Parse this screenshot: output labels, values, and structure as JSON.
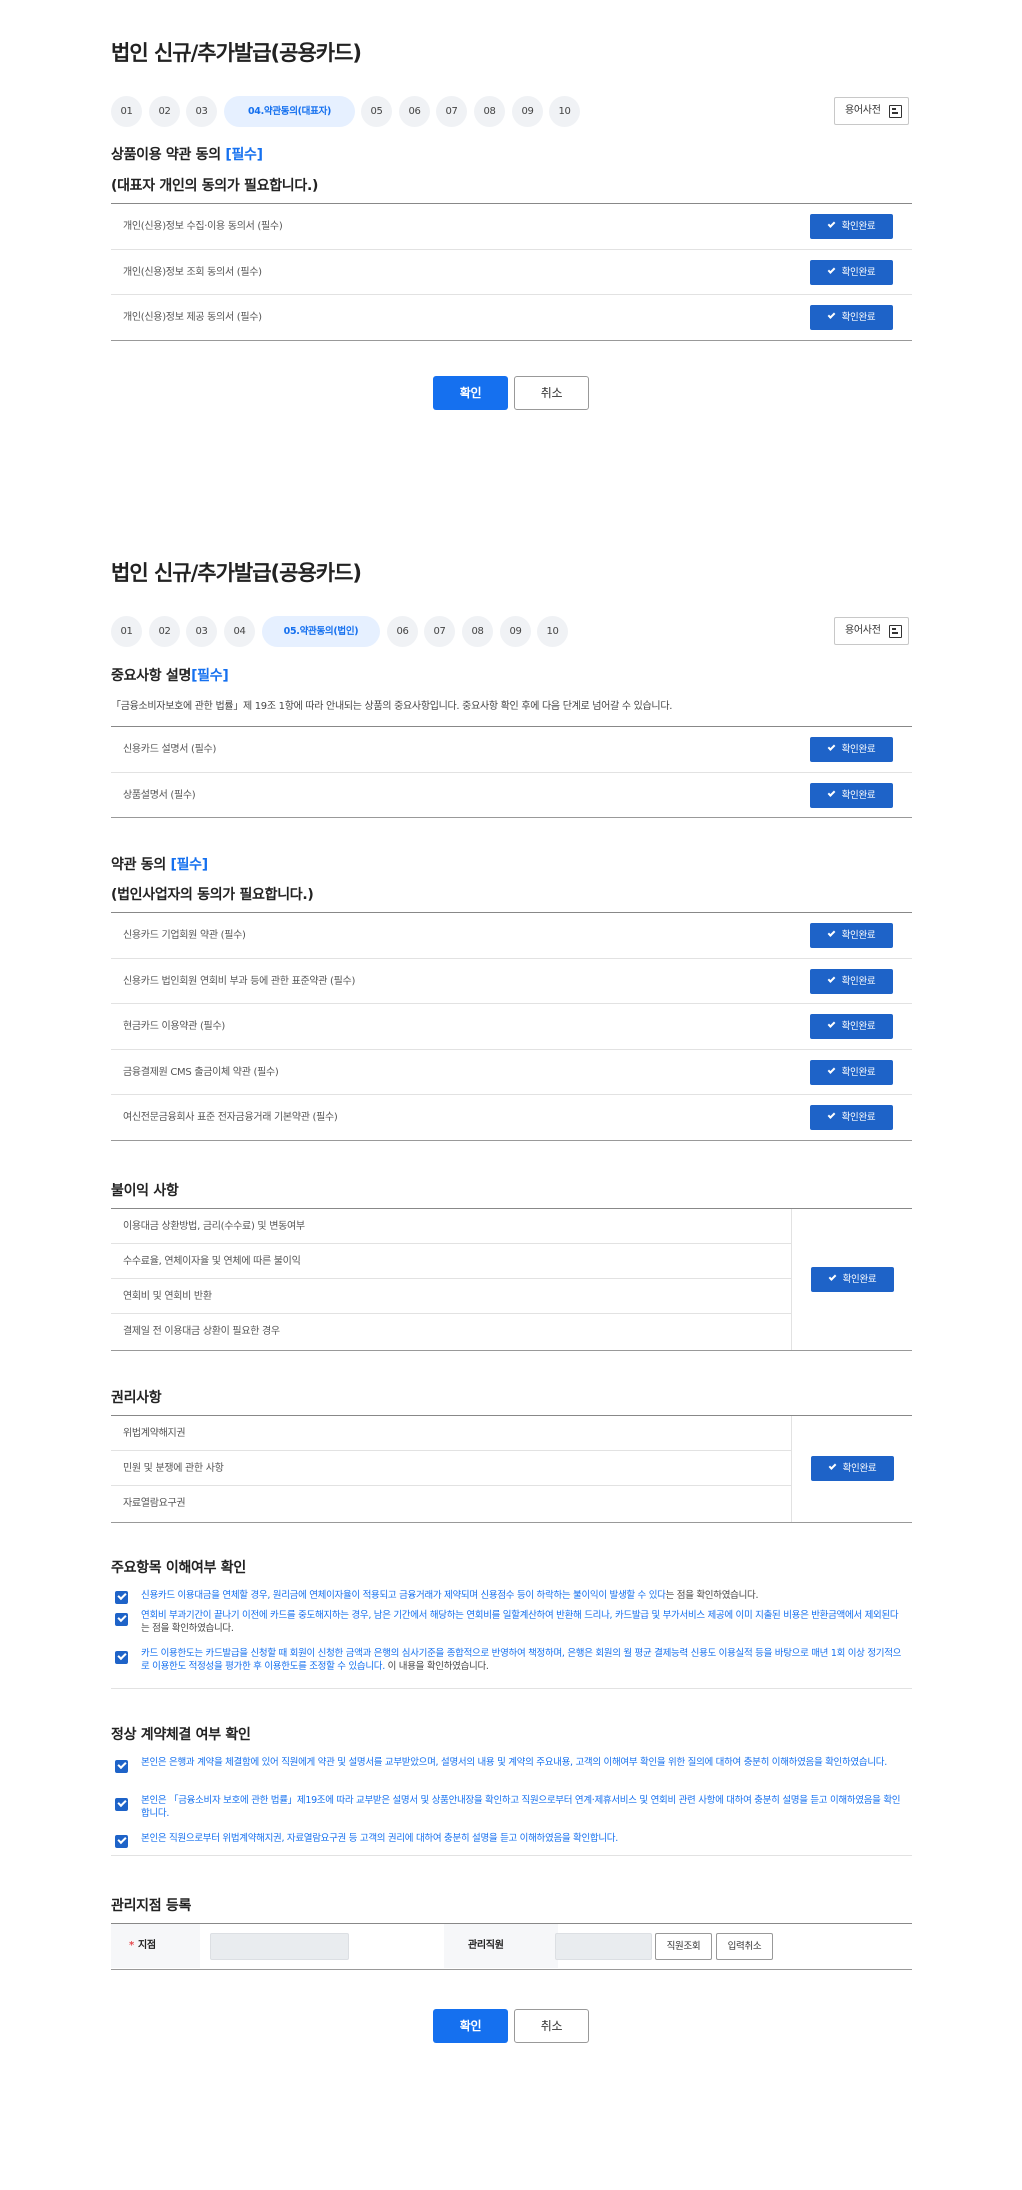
{
  "top": {
    "title": "법인 신규/추가발급(공용카드)",
    "steps": [
      "01",
      "02",
      "03",
      "04.약관동의(대표자)",
      "05",
      "06",
      "07",
      "08",
      "09",
      "10"
    ],
    "dict_label": "용어사전",
    "agree_title": "상품이용 약관 동의",
    "agree_req": "[필수]",
    "agree_sub": "(대표자 개인의 동의가 필요합니다.)",
    "rows": [
      "개인(신용)정보 수집·이용 동의서 (필수)",
      "개인(신용)정보 조회 동의서 (필수)",
      "개인(신용)정보 제공 동의서 (필수)"
    ],
    "confirm_done": "확인완료",
    "ok": "확인",
    "cancel": "취소"
  },
  "bottom": {
    "title": "법인 신규/추가발급(공용카드)",
    "steps": [
      "01",
      "02",
      "03",
      "04",
      "05.약관동의(법인)",
      "06",
      "07",
      "08",
      "09",
      "10"
    ],
    "dict_label": "용어사전",
    "important_title": "중요사항 설명",
    "important_req": "[필수]",
    "important_note": "「금융소비자보호에 관한 법률」제 19조 1항에 따라 안내되는 상품의 중요사항입니다. 중요사항 확인 후에 다음 단계로 넘어갈 수 있습니다.",
    "important_rows": [
      "신용카드 설명서 (필수)",
      "상품설명서 (필수)"
    ],
    "terms_title": "약관 동의",
    "terms_req": "[필수]",
    "terms_sub": "(법인사업자의 동의가 필요합니다.)",
    "terms_rows": [
      "신용카드 기업회원 약관 (필수)",
      "신용카드 법인회원 연회비 부과 등에 관한 표준약관 (필수)",
      "현금카드 이용약관 (필수)",
      "금융결제원 CMS 출금이체 약관 (필수)",
      "여신전문금융회사 표준 전자금융거래 기본약관 (필수)"
    ],
    "disadv_title": "불이익 사항",
    "disadv_rows": [
      "이용대금 상환방법, 금리(수수료) 및 변동여부",
      "수수료율, 연체이자율 및 연체에 따른 불이익",
      "연회비 및 연회비 반환",
      "결제일 전 이용대금 상환이 필요한 경우"
    ],
    "rights_title": "권리사항",
    "rights_rows": [
      "위법계약해지권",
      "민원 및 분쟁에 관한 사항",
      "자료열람요구권"
    ],
    "understand_title": "주요항목 이해여부 확인",
    "understand_items": [
      {
        "blue": "신용카드 이용대금을 연체할 경우, 원리금에 연체이자율이 적용되고 금융거래가 제약되며 신용점수 등이 하락하는 불이익이 발생할 수 있다",
        "black": "는 점을 확인하였습니다."
      },
      {
        "blue": "연회비 부과기간이 끝나기 이전에 카드를 중도해지하는 경우, 남은 기간에서 해당하는 연회비를 일할계산하여 반환해 드리나, 카드발급 및 부가서비스 제공에 이미 지출된 비용은 반환금액에서 제외된다",
        "black": "는 점을 확인하였습니다."
      },
      {
        "blue": "카드 이용한도는 카드발급을 신청할 때 회원이 신청한 금액과 은행의 심사기준을 종합적으로 반영하여 책정하며, 은행은 회원의 월 평균 결제능력 신용도 이용실적 등을 바탕으로 매년 1회 이상 정기적으로 이용한도 적정성을 평가한 후 이용한도를 조정할 수 있습니다.",
        "black": " 이 내용을 확인하였습니다."
      }
    ],
    "contract_title": "정상 계약체결 여부 확인",
    "contract_items": [
      {
        "blue": "본인은 은행과 계약을 체결함에 있어 직원에게 약관 및 설명서를 교부받았으며, 설명서의 내용 및 계약의 주요내용, 고객의 이해여부 확인을 위한 질의에 대하여 충분히 이해하였음을 확인하였습니다.",
        "black": ""
      },
      {
        "blue": "본인은 「금융소비자 보호에 관한 법률」제19조에 따라 교부받은 설명서 및 상품안내장을 확인하고 직원으로부터 연계·제휴서비스 및 연회비 관련 사항에 대하여 충분히 설명을 듣고 이해하였음을 확인합니다.",
        "black": ""
      },
      {
        "blue": "본인은 직원으로부터 위법계약해지권, 자료열람요구권 등 고객의 권리에 대하여 충분히 설명을 듣고 이해하였음을 확인합니다.",
        "black": ""
      }
    ],
    "branch_title": "관리지점 등록",
    "branch_star": "*",
    "branch_label": "지점",
    "staff_label": "관리직원",
    "staff_search": "직원조회",
    "input_cancel": "입력취소",
    "confirm_done": "확인완료",
    "ok": "확인",
    "cancel": "취소"
  },
  "colors": {
    "accent": "#1570ef",
    "confirm_button": "#1e63c8",
    "step_active_bg": "#e6f0ff"
  }
}
